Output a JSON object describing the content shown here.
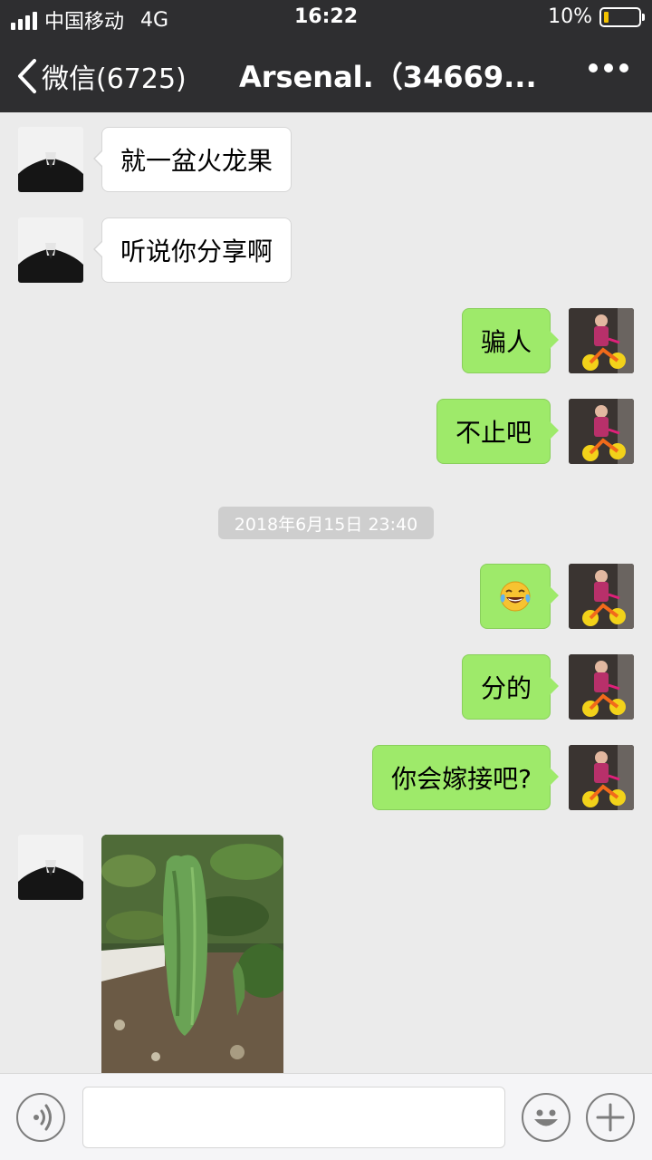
{
  "status_bar": {
    "carrier": "中国移动",
    "network": "4G",
    "time": "16:22",
    "battery": "10%",
    "battery_level": 0.1
  },
  "nav": {
    "back_label": "微信(6725)",
    "title": "Arsenal.（34669..."
  },
  "messages": [
    {
      "side": "left",
      "text": "就一盆火龙果"
    },
    {
      "side": "left",
      "text": "听说你分享啊"
    },
    {
      "side": "right",
      "text": "骗人"
    },
    {
      "side": "right",
      "text": "不止吧"
    },
    {
      "side": "right",
      "text": "😂"
    },
    {
      "side": "right",
      "text": "分的"
    },
    {
      "side": "right",
      "text": "你会嫁接吧?"
    },
    {
      "side": "left",
      "type": "image"
    }
  ],
  "timestamp": "2018年6月15日 23:40",
  "input": {
    "value": "",
    "placeholder": ""
  },
  "colors": {
    "header_bg": "#2e2e30",
    "chat_bg": "#ebebeb",
    "bubble_self": "#9eea6a",
    "bubble_other": "#ffffff",
    "battery_fill": "#f3c200"
  },
  "icons": [
    "back-chevron-icon",
    "more-icon",
    "voice-icon",
    "emoji-icon",
    "plus-icon"
  ]
}
